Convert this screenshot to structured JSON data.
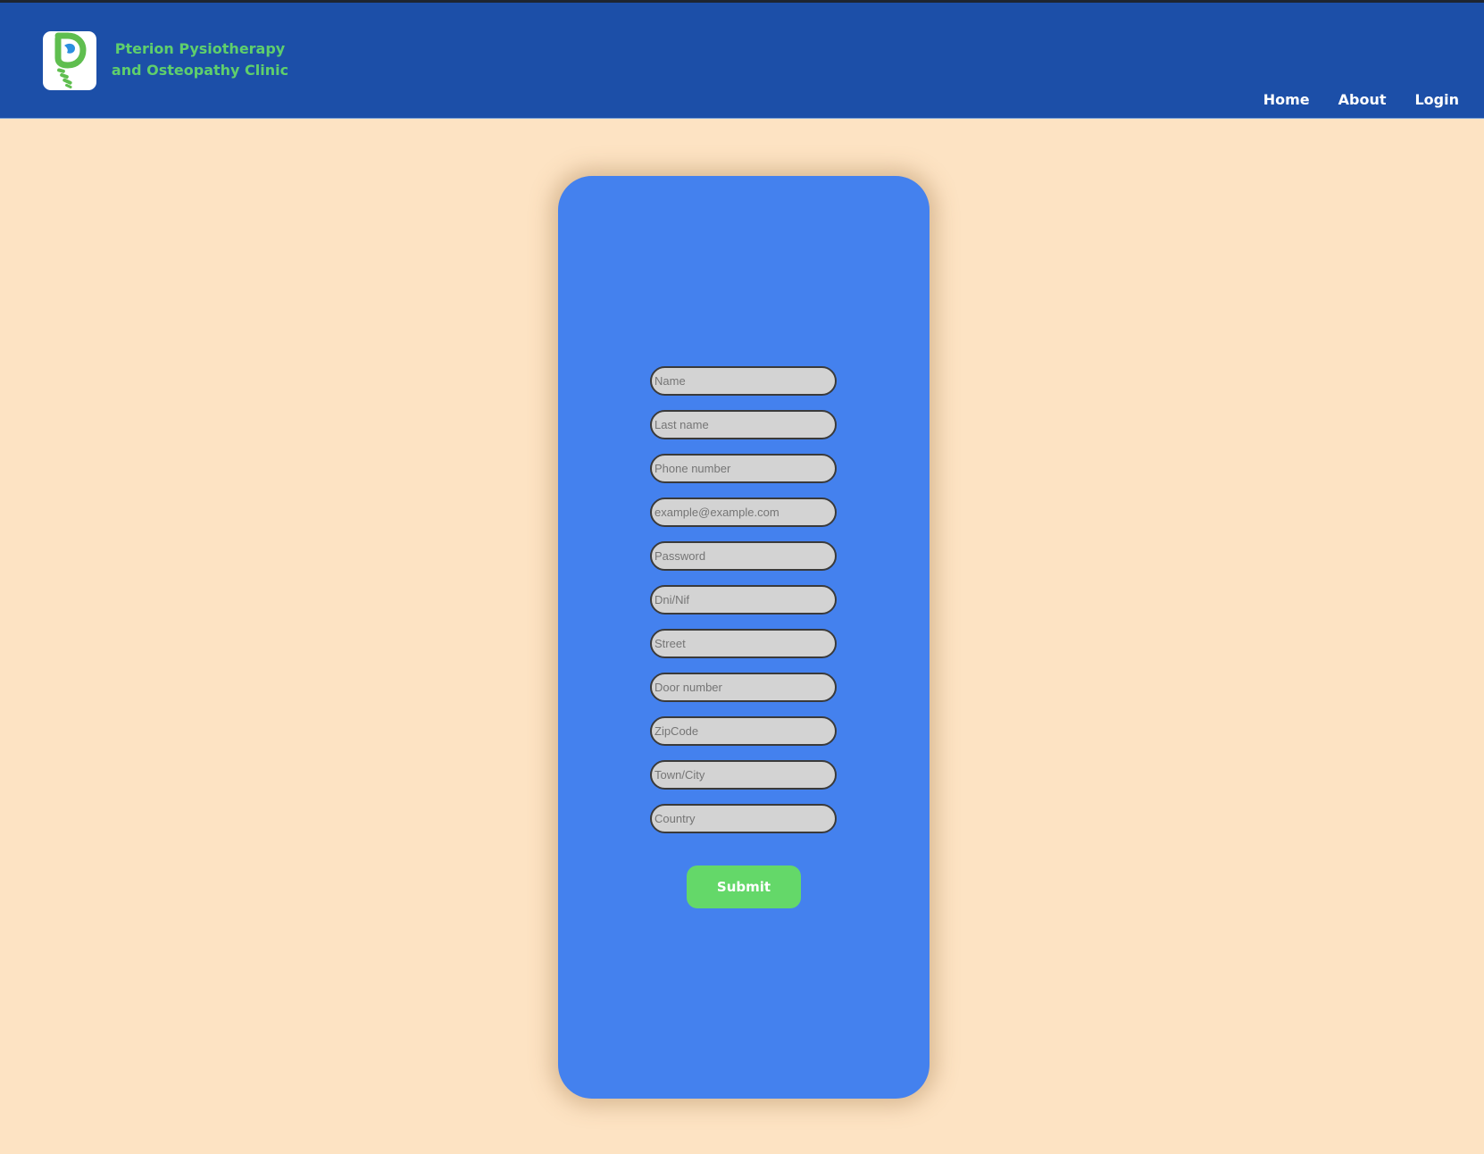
{
  "header": {
    "logo_icon": "physio-spine-logo-icon",
    "clinic_name": "Pterion Pysiotherapy and Osteopathy Clinic",
    "background_color": "#1c4fa8",
    "title_color": "#5fcf6c"
  },
  "nav": {
    "items": [
      {
        "label": "Home"
      },
      {
        "label": "About"
      },
      {
        "label": "Login"
      }
    ]
  },
  "form": {
    "fields": [
      {
        "placeholder": "Name"
      },
      {
        "placeholder": "Last name"
      },
      {
        "placeholder": "Phone number"
      },
      {
        "placeholder": "example@example.com"
      },
      {
        "placeholder": "Password"
      },
      {
        "placeholder": "Dni/Nif"
      },
      {
        "placeholder": "Street"
      },
      {
        "placeholder": "Door number"
      },
      {
        "placeholder": "ZipCode"
      },
      {
        "placeholder": "Town/City"
      },
      {
        "placeholder": "Country"
      }
    ],
    "submit_label": "Submit",
    "card_color": "#4481ee",
    "submit_color": "#64d869"
  },
  "page": {
    "background_color": "#fde3c3"
  }
}
